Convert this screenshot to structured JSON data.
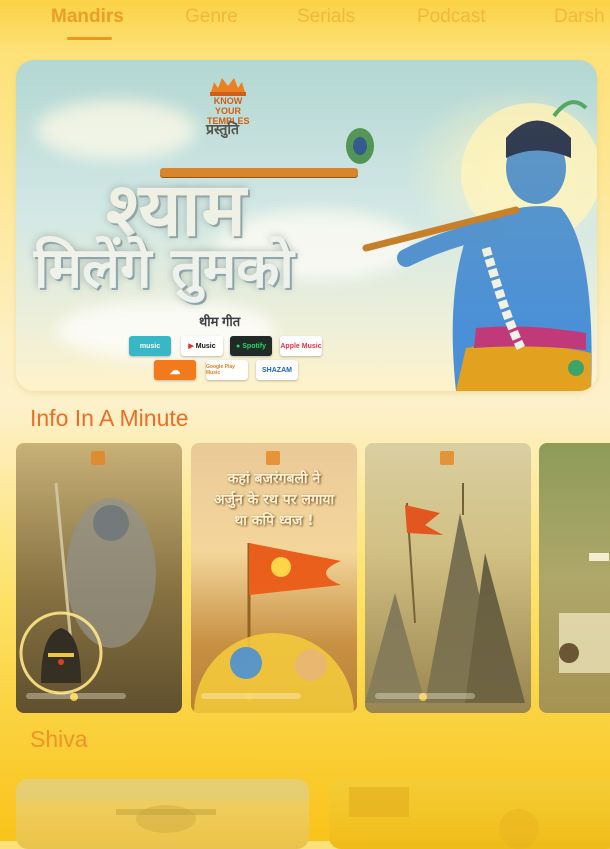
{
  "tabs": [
    {
      "label": "Mandirs",
      "active": true
    },
    {
      "label": "Genre",
      "active": false
    },
    {
      "label": "Serials",
      "active": false
    },
    {
      "label": "Podcast",
      "active": false
    },
    {
      "label": "Darsh",
      "active": false
    }
  ],
  "hero": {
    "logo_text_1": "KNOW YOUR",
    "logo_text_2": "TEMPLES",
    "presents": "प्रस्तुति",
    "title_line1": "श्याम",
    "title_line2": "मिलेंगे तुमको",
    "subtitle": "थीम गीत",
    "platforms_row1": [
      {
        "label": "music",
        "brand": "amazon-music",
        "bg": "#38b7c7",
        "fg": "#ffffff"
      },
      {
        "label": "Music",
        "brand": "youtube-music",
        "bg": "#ffffff",
        "fg": "#111111"
      },
      {
        "label": "Spotify",
        "brand": "spotify",
        "bg": "#1f2a28",
        "fg": "#29d460"
      },
      {
        "label": "Apple Music",
        "brand": "apple-music",
        "bg": "#ffffff",
        "fg": "#e9304a"
      }
    ],
    "platforms_row2": [
      {
        "label": "",
        "brand": "soundcloud",
        "bg": "#f2781c",
        "fg": "#ffffff"
      },
      {
        "label": "Google Play Music",
        "brand": "google-play-music",
        "bg": "#ffffff",
        "fg": "#e67c1c"
      },
      {
        "label": "SHAZAM",
        "brand": "shazam",
        "bg": "#ffffff",
        "fg": "#1a64b8"
      }
    ]
  },
  "sections": {
    "info_title": "Info In A Minute",
    "shiva_title": "Shiva"
  },
  "info_cards": [
    {
      "theme": "shiva",
      "caption_line1": "",
      "caption_line2": "",
      "caption_line3": ""
    },
    {
      "theme": "arjun-flag",
      "caption_line1": "कहां बजरंगबली ने",
      "caption_line2": "अर्जुन के रथ पर लगाया",
      "caption_line3": "था कपि ध्वज !"
    },
    {
      "theme": "temple-flag",
      "caption_line1": "",
      "caption_line2": "",
      "caption_line3": ""
    },
    {
      "theme": "street",
      "caption_line1": "",
      "caption_line2": "",
      "caption_line3": ""
    }
  ],
  "colors": {
    "accent": "#ee6b26",
    "tab_active": "#e79421",
    "tab_inactive": "#f0b13d",
    "background": "#fde89a"
  }
}
